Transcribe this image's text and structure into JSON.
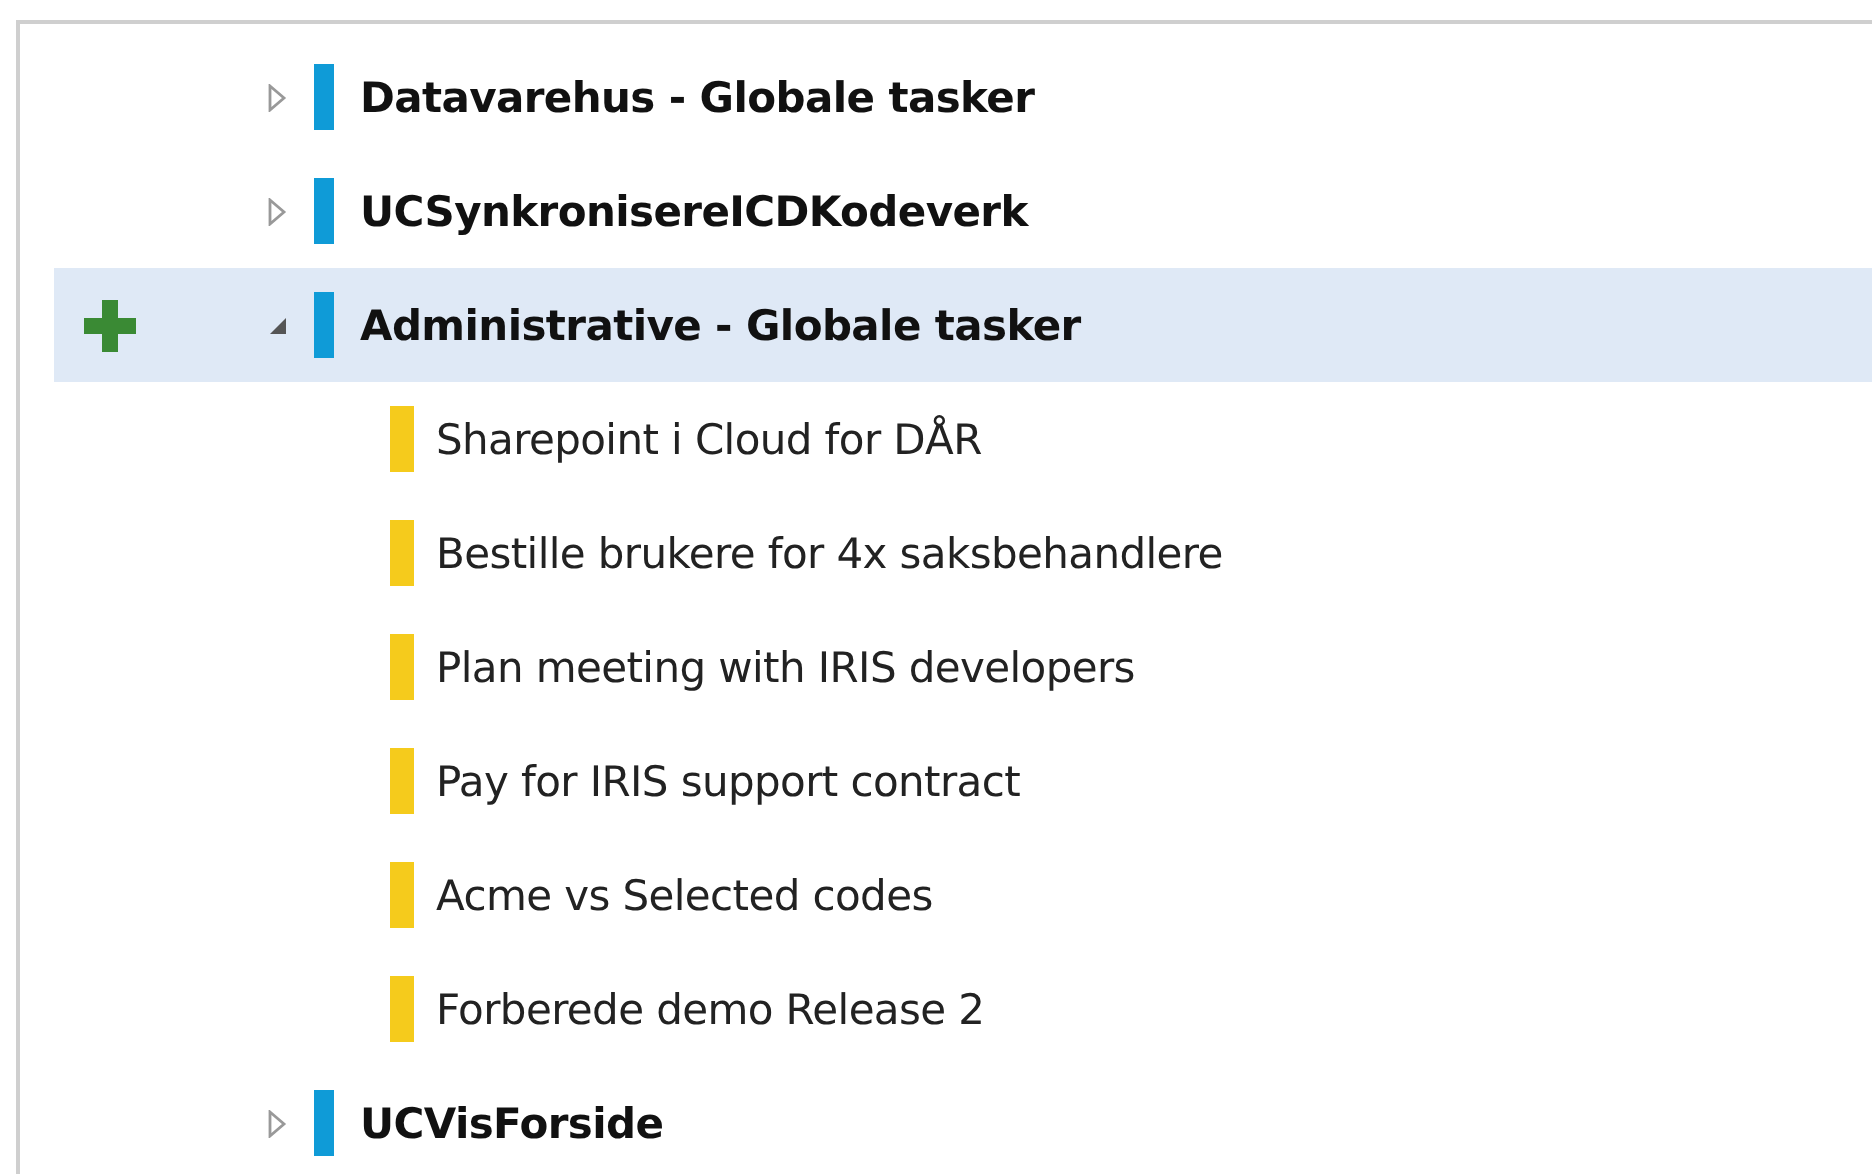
{
  "tree": [
    {
      "label": "Datavarehus - Globale tasker",
      "color": "#0f9bd7",
      "expanded": false,
      "selected": false
    },
    {
      "label": "UCSynkronisereICDKodeverk",
      "color": "#0f9bd7",
      "expanded": false,
      "selected": false
    },
    {
      "label": "Administrative - Globale tasker",
      "color": "#0f9bd7",
      "expanded": true,
      "selected": true,
      "children": [
        {
          "label": "Sharepoint i Cloud for DÅR",
          "color": "#f5cb1c"
        },
        {
          "label": "Bestille brukere for 4x saksbehandlere",
          "color": "#f5cb1c"
        },
        {
          "label": "Plan meeting with IRIS developers",
          "color": "#f5cb1c"
        },
        {
          "label": "Pay for IRIS support contract",
          "color": "#f5cb1c"
        },
        {
          "label": "Acme vs Selected codes",
          "color": "#f5cb1c"
        },
        {
          "label": "Forberede demo Release 2",
          "color": "#f5cb1c"
        }
      ]
    },
    {
      "label": "UCVisForside",
      "color": "#0f9bd7",
      "expanded": false,
      "selected": false
    }
  ]
}
